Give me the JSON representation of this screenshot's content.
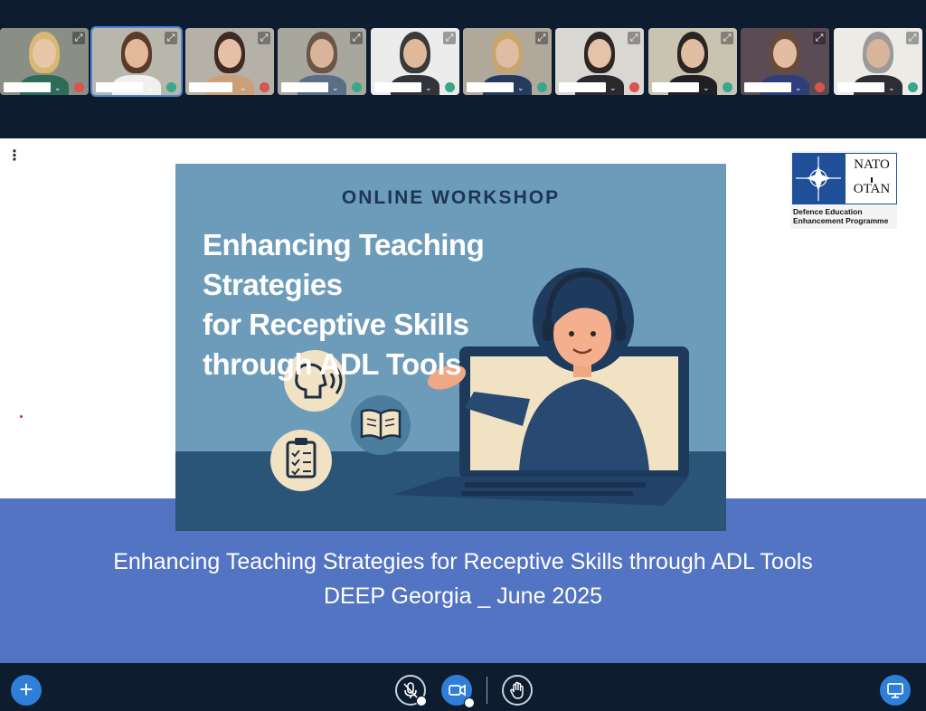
{
  "participants": [
    {
      "id": "p1",
      "mic": "red",
      "colors": {
        "wall": "#8a8f86",
        "skin": "#e8c7a8",
        "hair": "#d9b873",
        "body": "#2f6b59"
      }
    },
    {
      "id": "p2",
      "mic": "teal",
      "active": true,
      "colors": {
        "wall": "#b8b7ab",
        "skin": "#e2b99b",
        "hair": "#5a3a2a",
        "body": "#f0f0ee"
      }
    },
    {
      "id": "p3",
      "mic": "red",
      "colors": {
        "wall": "#b6b1a8",
        "skin": "#e6c0a4",
        "hair": "#3e2a22",
        "body": "#caa07a"
      }
    },
    {
      "id": "p4",
      "mic": "teal",
      "colors": {
        "wall": "#a7a79d",
        "skin": "#d8b49a",
        "hair": "#6a5548",
        "body": "#5a6f85"
      }
    },
    {
      "id": "p5",
      "mic": "teal",
      "colors": {
        "wall": "#ececec",
        "skin": "#e0b89a",
        "hair": "#3a3a3a",
        "body": "#33333a"
      }
    },
    {
      "id": "p6",
      "mic": "teal",
      "colors": {
        "wall": "#b1a89c",
        "skin": "#e0bca2",
        "hair": "#c7a56b",
        "body": "#243a5e"
      }
    },
    {
      "id": "p7",
      "mic": "red",
      "colors": {
        "wall": "#d9d7d2",
        "skin": "#e4c3a8",
        "hair": "#2e2622",
        "body": "#2a2a2e"
      }
    },
    {
      "id": "p8",
      "mic": "teal",
      "colors": {
        "wall": "#c9c3b2",
        "skin": "#e1bda2",
        "hair": "#2a2422",
        "body": "#1f1f24"
      }
    },
    {
      "id": "p9",
      "mic": "red",
      "colors": {
        "wall": "#5a4b55",
        "skin": "#e2bda2",
        "hair": "#6b4a3a",
        "body": "#2f3e7a"
      }
    },
    {
      "id": "p10",
      "mic": "teal",
      "colors": {
        "wall": "#ecebe6",
        "skin": "#d8b49a",
        "hair": "#9a9a9a",
        "body": "#2d2d33"
      }
    }
  ],
  "presentation": {
    "slide": {
      "kicker": "ONLINE WORKSHOP",
      "title_lines": [
        "Enhancing Teaching Strategies",
        "for Receptive Skills",
        "through ADL Tools"
      ]
    },
    "logo": {
      "top": "NATO",
      "bottom": "OTAN",
      "sub_line1": "Defence Education",
      "sub_line2": "Enhancement Programme"
    },
    "caption_line1": "Enhancing Teaching Strategies for Receptive Skills through ADL Tools",
    "caption_line2": "DEEP Georgia _ June 2025"
  },
  "icons": {
    "menu": "vertical-ellipsis-icon",
    "expand": "expand-icon",
    "plus": "plus-icon",
    "mic": "microphone-muted-icon",
    "camera": "camera-icon",
    "hand": "raise-hand-icon",
    "share": "screen-share-icon"
  },
  "colors": {
    "app_background": "#0d1c2e",
    "accent_blue": "#2f7fd8",
    "caption_band": "#5374c2",
    "slide_background": "#6d9cba"
  }
}
